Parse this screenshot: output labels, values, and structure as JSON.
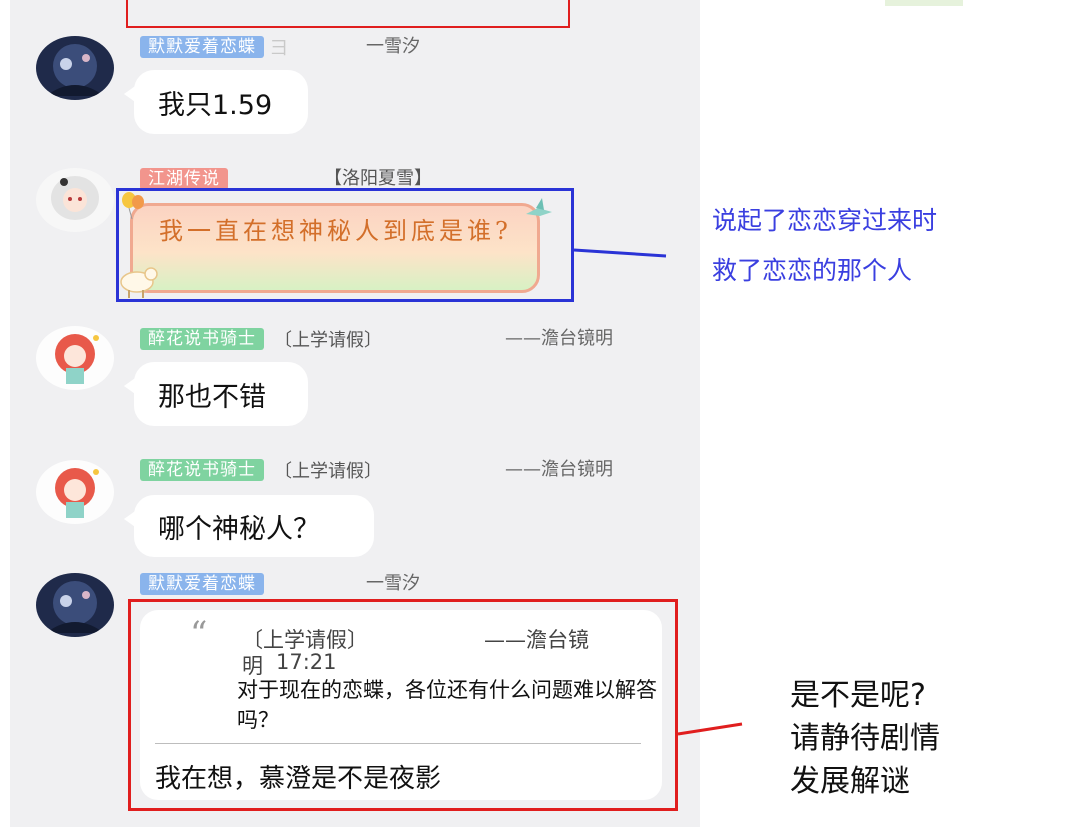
{
  "messages": [
    {
      "badge": "默默爱着恋蝶",
      "trail": "彐",
      "signature": "一雪汐",
      "text": "我只1.59"
    },
    {
      "badge": "江湖传说",
      "tag": "【洛阳夏雪】",
      "text": "我一直在想神秘人到底是谁?"
    },
    {
      "badge": "醉花说书骑士",
      "tag": "〔上学请假〕",
      "signature": "——澹台镜明",
      "text": "那也不错"
    },
    {
      "badge": "醉花说书骑士",
      "tag": "〔上学请假〕",
      "signature": "——澹台镜明",
      "text": "哪个神秘人？"
    },
    {
      "badge": "默默爱着恋蝶",
      "signature": "一雪汐",
      "quote": {
        "mark": "“",
        "tag": "〔上学请假〕",
        "signature": "——澹台镜",
        "signature_cont": "明",
        "time": "17:21",
        "text": "对于现在的恋蝶，各位还有什么问题难以解答吗？"
      },
      "text": "我在想，慕澄是不是夜影"
    }
  ],
  "annotations": {
    "blue_line1": "说起了恋恋穿过来时",
    "blue_line2": "救了恋恋的那个人",
    "black_line1": "是不是呢?",
    "black_line2": "请静待剧情",
    "black_line3": "发展解谜"
  },
  "colors": {
    "blue_annotation": "#3a3fe0",
    "red_box": "#e01e1e",
    "badge_blue": "#8ab4ec",
    "badge_pink": "#f2958d",
    "badge_green": "#7fd3a0"
  }
}
